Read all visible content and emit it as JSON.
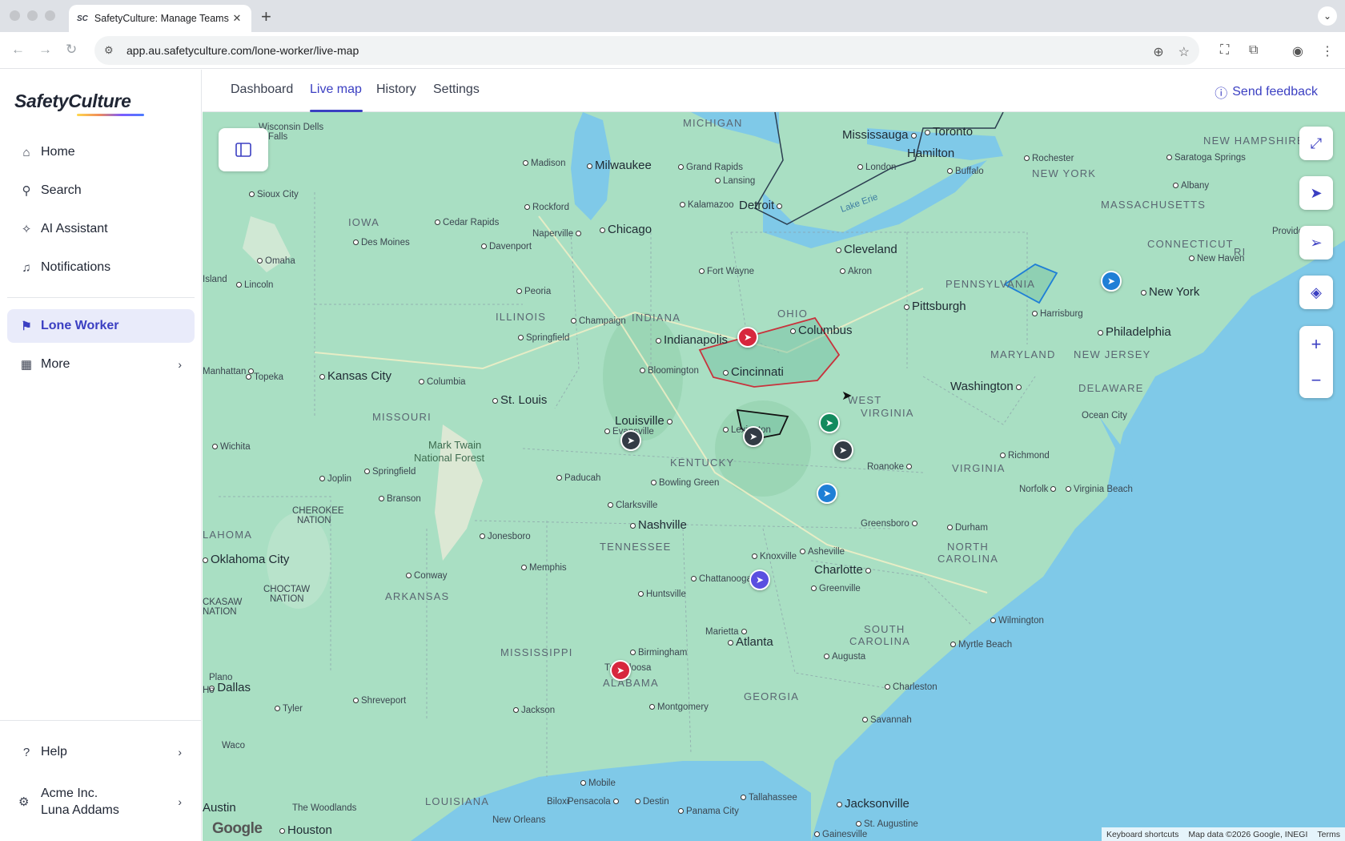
{
  "browser": {
    "tab_title": "SafetyCulture: Manage Teams",
    "favicon_text": "SC",
    "url": "app.au.safetyculture.com/lone-worker/live-map"
  },
  "sidebar": {
    "logo": "SafetyCulture",
    "items": [
      {
        "label": "Home",
        "icon": "home-icon"
      },
      {
        "label": "Search",
        "icon": "search-icon"
      },
      {
        "label": "AI Assistant",
        "icon": "sparkle-icon"
      },
      {
        "label": "Notifications",
        "icon": "bell-icon"
      },
      {
        "label": "Lone Worker",
        "icon": "lone-worker-icon",
        "active": true
      },
      {
        "label": "More",
        "icon": "grid-icon"
      }
    ],
    "help_label": "Help",
    "account": {
      "org": "Acme Inc.",
      "user": "Luna Addams"
    }
  },
  "header": {
    "tabs": [
      {
        "label": "Dashboard"
      },
      {
        "label": "Live map",
        "active": true
      },
      {
        "label": "History"
      },
      {
        "label": "Settings"
      }
    ],
    "feedback_label": "Send feedback"
  },
  "map": {
    "labels": {
      "states": [
        "MICHIGAN",
        "IOWA",
        "ILLINOIS",
        "INDIANA",
        "OHIO",
        "PENNSYLVANIA",
        "NEW YORK",
        "MASSACHUSETTS",
        "CONNECTICUT",
        "RI",
        "NEW HAMPSHIRE",
        "MARYLAND",
        "NEW JERSEY",
        "DELAWARE",
        "WEST",
        "VIRGINIA",
        "VIRGINIA",
        "MISSOURI",
        "KENTUCKY",
        "TENNESSEE",
        "NORTH",
        "CAROLINA",
        "ARKANSAS",
        "MISSISSIPPI",
        "ALABAMA",
        "GEORGIA",
        "SOUTH",
        "CAROLINA",
        "LOUISIANA",
        "LAHOMA",
        "CHEROKEE",
        "NATION",
        "CHOCTAW",
        "NATION",
        "CKASAW",
        "NATION"
      ],
      "cities": [
        "Chicago",
        "Milwaukee",
        "Detroit",
        "Toronto",
        "Mississauga",
        "Hamilton",
        "Cleveland",
        "Pittsburgh",
        "Columbus",
        "Cincinnati",
        "Indianapolis",
        "Louisville",
        "St. Louis",
        "Kansas City",
        "Nashville",
        "Washington",
        "Philadelphia",
        "New York",
        "Charlotte",
        "Atlanta",
        "Jacksonville",
        "Oklahoma City",
        "Dallas",
        "Houston",
        "Austin"
      ],
      "towns": [
        "Wisconsin Dells",
        "Madison",
        "Grand Rapids",
        "Lansing",
        "Kalamazoo",
        "Rockford",
        "Cedar Rapids",
        "Des Moines",
        "Naperville",
        "Davenport",
        "Peoria",
        "Springfield",
        "Champaign",
        "Fort Wayne",
        "Akron",
        "London",
        "Buffalo",
        "Rochester",
        "Saratoga Springs",
        "Albany",
        "Providence",
        "New Haven",
        "Harrisburg",
        "Bloomington",
        "Columbia",
        "Topeka",
        "Lincoln",
        "Omaha",
        "Sioux City",
        "Island",
        "Wichita",
        "Joplin",
        "Springfield",
        "Branson",
        "Mark Twain",
        "National Forest",
        "Evansville",
        "Lexington",
        "Paducah",
        "Bowling Green",
        "Clarksville",
        "Jonesboro",
        "Memphis",
        "Huntsville",
        "Knoxville",
        "Asheville",
        "Roanoke",
        "Greensboro",
        "Durham",
        "Richmond",
        "Norfolk",
        "Virginia Beach",
        "Ocean City",
        "Wilmington",
        "Myrtle Beach",
        "Charleston",
        "Augusta",
        "Savannah",
        "Greenville",
        "Chattanooga",
        "Marietta",
        "Birmingham",
        "Tuscaloosa",
        "Montgomery",
        "Jackson",
        "Shreveport",
        "Tyler",
        "Waco",
        "Plano",
        "Conway",
        "Mobile",
        "Pensacola",
        "Destin",
        "Panama City",
        "Tallahassee",
        "Biloxi",
        "New Orleans",
        "The Woodlands",
        "St. Augustine",
        "Gainesville",
        "Manhattan",
        "Lake Erie",
        "Falls",
        "Ho"
      ]
    },
    "pins": [
      {
        "color": "#d7263d",
        "name": "red-worker-pin-columbus"
      },
      {
        "color": "#333b45",
        "name": "dark-worker-pin-evansville"
      },
      {
        "color": "#333b45",
        "name": "dark-worker-pin-kentucky"
      },
      {
        "color": "#138a5e",
        "name": "green-worker-pin-wv"
      },
      {
        "color": "#333b45",
        "name": "dark-worker-pin-roanoke"
      },
      {
        "color": "#1f7fd6",
        "name": "blue-worker-pin-nc"
      },
      {
        "color": "#1f7fd6",
        "name": "blue-worker-pin-nj"
      },
      {
        "color": "#5a4fe0",
        "name": "purple-worker-pin-greenville"
      },
      {
        "color": "#d7263d",
        "name": "red-worker-pin-alabama"
      }
    ],
    "google_label": "Google",
    "attribution": {
      "shortcuts": "Keyboard shortcuts",
      "data": "Map data ©2026 Google, INEGI",
      "terms": "Terms"
    }
  },
  "colors": {
    "accent": "#3b3fc2",
    "active_bg": "#e9ebfa",
    "land": "#a9dfc3",
    "water": "#7fc9e8"
  }
}
